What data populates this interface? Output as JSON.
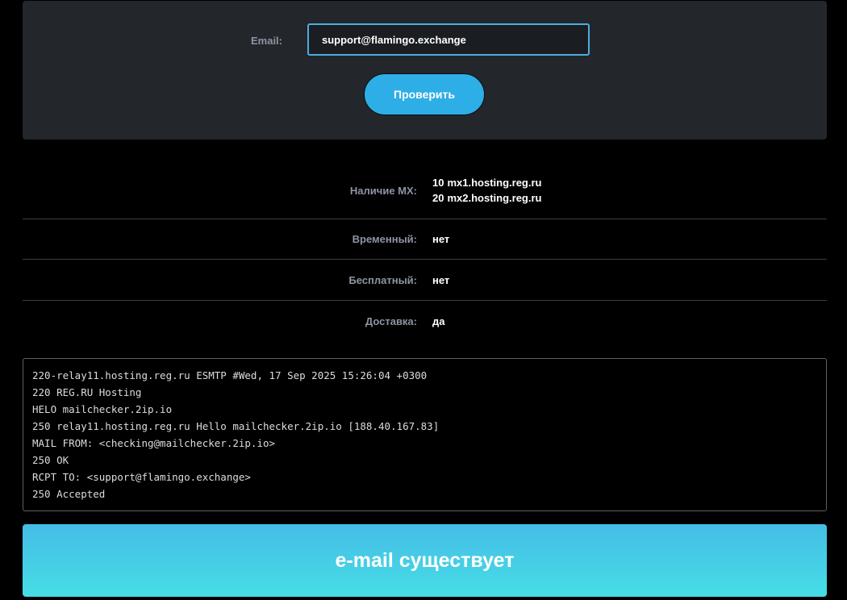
{
  "form": {
    "email_label": "Email:",
    "email_value": "support@flamingo.exchange",
    "submit_label": "Проверить"
  },
  "results": {
    "mx": {
      "label": "Наличие MX:",
      "records": [
        {
          "priority": "10",
          "host": "mx1.hosting.reg.ru"
        },
        {
          "priority": "20",
          "host": "mx2.hosting.reg.ru"
        }
      ]
    },
    "temporary": {
      "label": "Временный:",
      "value": "нет"
    },
    "free": {
      "label": "Бесплатный:",
      "value": "нет"
    },
    "delivery": {
      "label": "Доставка:",
      "value": "да"
    }
  },
  "smtp_log": [
    "220-relay11.hosting.reg.ru ESMTP #Wed, 17 Sep 2025 15:26:04 +0300",
    "220 REG.RU Hosting",
    "HELO mailchecker.2ip.io",
    "250 relay11.hosting.reg.ru Hello mailchecker.2ip.io [188.40.167.83]",
    "MAIL FROM: <checking@mailchecker.2ip.io>",
    "250 OK",
    "RCPT TO: <support@flamingo.exchange>",
    "250 Accepted"
  ],
  "verdict": {
    "text": "e-mail существует",
    "colors": {
      "top": "#45bde6",
      "bottom": "#46dde6"
    }
  },
  "colors": {
    "panel_bg": "#23262b",
    "accent": "#2eaee6",
    "label": "#8d94a3"
  }
}
